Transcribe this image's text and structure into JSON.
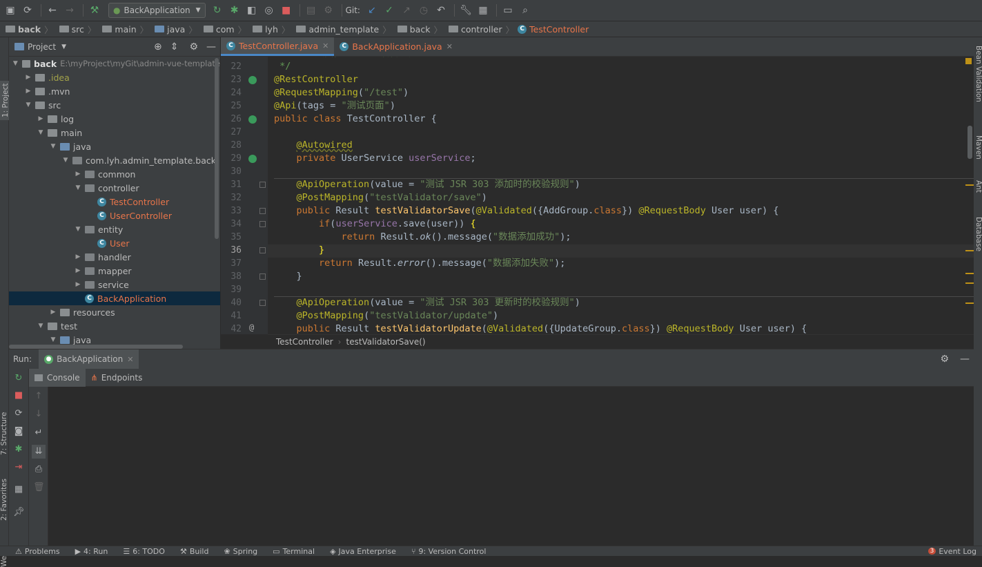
{
  "toolbar": {
    "run_config": "BackApplication",
    "git_label": "Git:"
  },
  "breadcrumb": [
    "back",
    "src",
    "main",
    "java",
    "com",
    "lyh",
    "admin_template",
    "back",
    "controller",
    "TestController"
  ],
  "project": {
    "title": "Project",
    "root_name": "back",
    "root_path": "E:\\myProject\\myGit\\admin-vue-template",
    "items": [
      {
        "label": ".idea",
        "depth": 1,
        "expanded": false,
        "type": "folder"
      },
      {
        "label": ".mvn",
        "depth": 1,
        "expanded": false,
        "type": "folder"
      },
      {
        "label": "src",
        "depth": 1,
        "expanded": true,
        "type": "folder"
      },
      {
        "label": "log",
        "depth": 2,
        "expanded": false,
        "type": "folder"
      },
      {
        "label": "main",
        "depth": 2,
        "expanded": true,
        "type": "folder"
      },
      {
        "label": "java",
        "depth": 3,
        "expanded": true,
        "type": "src"
      },
      {
        "label": "com.lyh.admin_template.back",
        "depth": 4,
        "expanded": true,
        "type": "pkg"
      },
      {
        "label": "common",
        "depth": 5,
        "expanded": false,
        "type": "pkg"
      },
      {
        "label": "controller",
        "depth": 5,
        "expanded": true,
        "type": "pkg"
      },
      {
        "label": "TestController",
        "depth": 6,
        "type": "class"
      },
      {
        "label": "UserController",
        "depth": 6,
        "type": "class"
      },
      {
        "label": "entity",
        "depth": 5,
        "expanded": true,
        "type": "pkg"
      },
      {
        "label": "User",
        "depth": 6,
        "type": "class"
      },
      {
        "label": "handler",
        "depth": 5,
        "expanded": false,
        "type": "pkg"
      },
      {
        "label": "mapper",
        "depth": 5,
        "expanded": false,
        "type": "pkg"
      },
      {
        "label": "service",
        "depth": 5,
        "expanded": false,
        "type": "pkg"
      },
      {
        "label": "BackApplication",
        "depth": 5,
        "type": "app",
        "selected": true
      },
      {
        "label": "resources",
        "depth": 3,
        "expanded": false,
        "type": "folder"
      },
      {
        "label": "test",
        "depth": 2,
        "expanded": true,
        "type": "folder"
      },
      {
        "label": "java",
        "depth": 3,
        "expanded": true,
        "type": "src"
      }
    ]
  },
  "tabs": [
    {
      "label": "TestController.java",
      "active": true
    },
    {
      "label": "BackApplication.java",
      "active": false
    }
  ],
  "code": {
    "line_numbers": [
      "22",
      "23",
      "24",
      "25",
      "26",
      "27",
      "28",
      "29",
      "30",
      "31",
      "32",
      "33",
      "34",
      "35",
      "36",
      "37",
      "38",
      "39",
      "40",
      "41",
      "42"
    ]
  },
  "editor_crumb": [
    "TestController",
    "testValidatorSave()"
  ],
  "run": {
    "label": "Run:",
    "config": "BackApplication",
    "tab_console": "Console",
    "tab_endpoints": "Endpoints"
  },
  "side_tools_left": [
    "1: Project",
    "7: Structure",
    "2: Favorites",
    "Web"
  ],
  "side_tools_right": [
    "Bean Validation",
    "Maven",
    "Ant",
    "Database"
  ],
  "status": [
    "Problems",
    "4: Run",
    "6: TODO",
    "Build",
    "Spring",
    "Terminal",
    "Java Enterprise",
    "9: Version Control"
  ],
  "event_log": {
    "count": "3",
    "label": "Event Log"
  },
  "colors": {
    "accent": "#4a88c7",
    "selection": "#0d293e",
    "modified_tab": "#e8754a"
  }
}
